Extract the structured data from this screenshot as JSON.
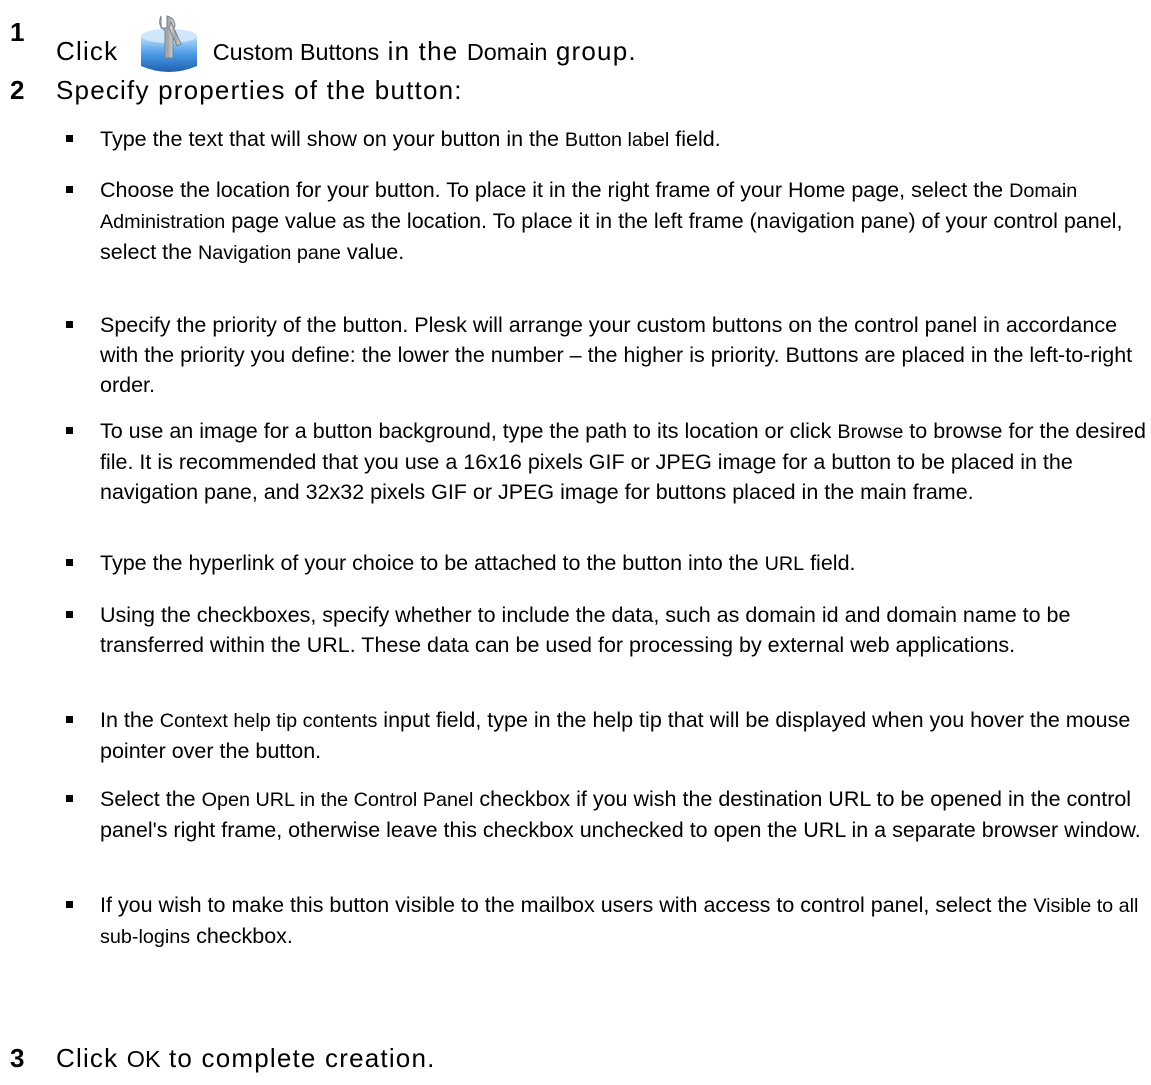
{
  "steps": [
    {
      "number": "1",
      "before": "Click ",
      "icon": "custom-buttons-icon",
      "ui1": "Custom Buttons",
      "mid": " in the ",
      "ui2": "Domain",
      "after": " group."
    },
    {
      "number": "2",
      "text": "Specify properties of the button:"
    },
    {
      "number": "3",
      "before": "Click ",
      "ui1": "OK",
      "after": " to complete creation."
    }
  ],
  "bullets": [
    {
      "p1": "Type the text that will show on your button in the ",
      "ui1": "Button label",
      "p2": " field."
    },
    {
      "p1": "Choose the location for your button. To place it in the right frame of your Home page, select the ",
      "ui1": "Domain Administration",
      "p2": " page value as the location. To place it in the left frame (navigation pane) of your control panel, select the ",
      "ui2": "Navigation pane",
      "p3": " value."
    },
    {
      "p1": "Specify the priority of the button. Plesk will arrange your custom buttons on the control panel in accordance with the priority you define: the lower the number – the higher is priority. Buttons are placed in the left-to-right order."
    },
    {
      "p1": "To use an image for a button background, type the path to its location or click ",
      "ui1": "Browse",
      "p2": " to browse for the desired file. It is recommended that you use a 16x16 pixels GIF or JPEG image for a button to be placed in the navigation pane, and 32x32 pixels GIF or JPEG image for buttons placed in the main frame."
    },
    {
      "p1": "Type the hyperlink of your choice to be attached to the button into the ",
      "ui1": "URL",
      "p2": " field."
    },
    {
      "p1": "Using the checkboxes, specify whether to include the data, such as domain id and domain name to be transferred within the URL. These data can be used for processing by external web applications."
    },
    {
      "p1": "In the ",
      "ui1": "Context help tip contents",
      "p2": " input field, type in the help tip that will be displayed when you hover the mouse pointer over the button."
    },
    {
      "p1": "Select the ",
      "ui1": "Open URL in the Control Panel",
      "p2": " checkbox if you wish the destination URL to be opened in the control panel's right frame, otherwise leave this checkbox unchecked to open the URL in a separate browser window."
    },
    {
      "p1": "If you wish to make this button visible to the mailbox users with access to control panel, select the ",
      "ui1": "Visible to all sub-logins",
      "p2": " checkbox."
    }
  ]
}
